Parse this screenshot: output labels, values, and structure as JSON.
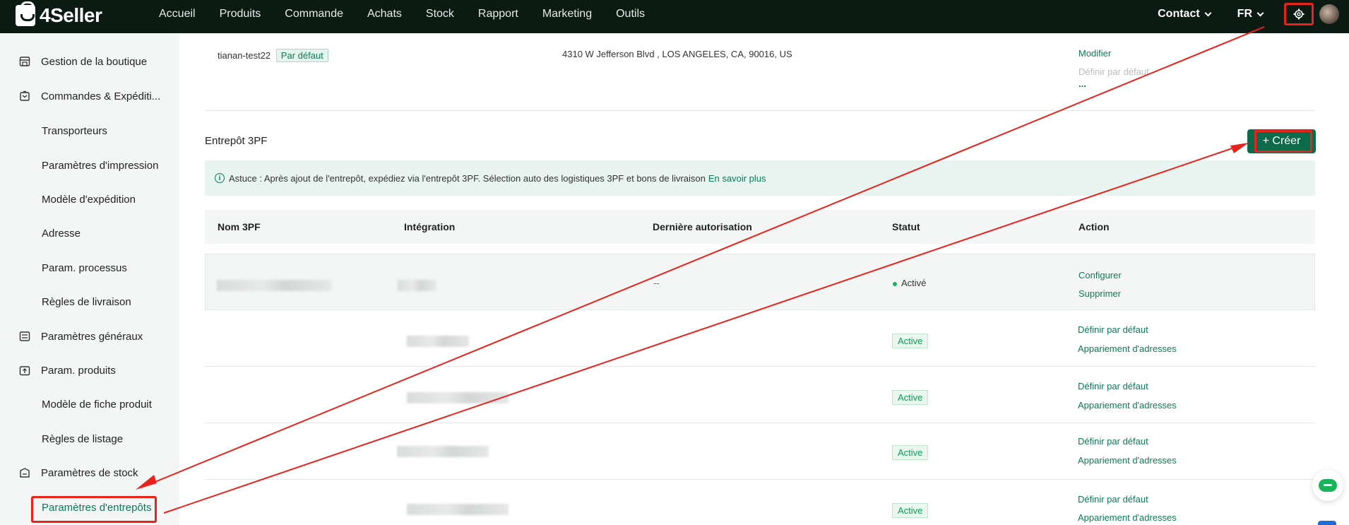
{
  "header": {
    "brand": "4Seller",
    "nav": [
      "Accueil",
      "Produits",
      "Commande",
      "Achats",
      "Stock",
      "Rapport",
      "Marketing",
      "Outils"
    ],
    "contact_label": "Contact",
    "lang_label": "FR",
    "settings_icon": "gear-icon"
  },
  "sidebar": {
    "items": [
      {
        "label": "Gestion de la boutique",
        "icon": "store-icon"
      },
      {
        "label": "Commandes & Expéditi...",
        "icon": "cart-icon"
      },
      {
        "label": "Transporteurs"
      },
      {
        "label": "Paramètres d'impression"
      },
      {
        "label": "Modèle d'expédition"
      },
      {
        "label": "Adresse"
      },
      {
        "label": "Param. processus"
      },
      {
        "label": "Règles de livraison"
      },
      {
        "label": "Paramètres généraux",
        "icon": "list-icon"
      },
      {
        "label": "Param. produits",
        "icon": "box-icon"
      },
      {
        "label": "Modèle de fiche produit"
      },
      {
        "label": "Règles de listage"
      },
      {
        "label": "Paramètres de stock",
        "icon": "warehouse-icon"
      },
      {
        "label": "Paramètres d'entrepôts",
        "active": true
      }
    ]
  },
  "address": {
    "name": "tianan-test22",
    "default_tag": "Par défaut",
    "full_address": "4310 W Jefferson Blvd , LOS ANGELES, CA, 90016, US",
    "modify_link": "Modifier",
    "set_default_link": "Définir par défaut",
    "more_link": "..."
  },
  "section": {
    "title": "Entrepôt 3PF",
    "create_button": "+ Créer",
    "tip_text": "Astuce : Après ajout de l'entrepôt, expédiez via l'entrepôt 3PF. Sélection auto des logistiques 3PF et bons de livraison",
    "tip_link": "En savoir plus"
  },
  "table": {
    "columns": [
      "Nom 3PF",
      "Intégration",
      "Dernière autorisation",
      "Statut",
      "Action"
    ],
    "rows": [
      {
        "last_auth": "--",
        "status": "Activé",
        "actions": [
          "Configurer",
          "Supprimer"
        ]
      },
      {
        "last_auth": "",
        "status": "Active",
        "actions": [
          "Définir par défaut",
          "Appariement d'adresses"
        ]
      },
      {
        "last_auth": "",
        "status": "Active",
        "actions": [
          "Définir par défaut",
          "Appariement d'adresses"
        ]
      },
      {
        "last_auth": "",
        "status": "Active",
        "actions": [
          "Définir par défaut",
          "Appariement d'adresses"
        ]
      },
      {
        "last_auth": "",
        "status": "Active",
        "actions": [
          "Définir par défaut",
          "Appariement d'adresses"
        ]
      }
    ]
  },
  "colors": {
    "topbar": "#0c1a14",
    "accent": "#0d6b4b",
    "link": "#0d7a55",
    "annotation_red": "#e8231c"
  }
}
